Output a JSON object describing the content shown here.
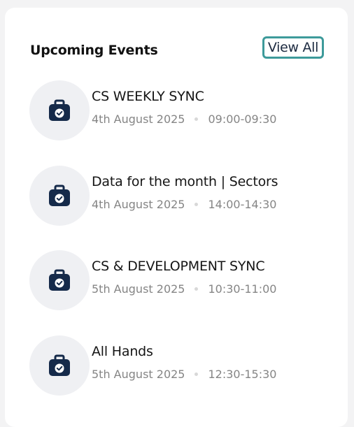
{
  "widget": {
    "title": "Upcoming Events",
    "view_all_label": "View All"
  },
  "events": [
    {
      "title": "CS WEEKLY SYNC",
      "date": "4th August 2025",
      "time": "09:00-09:30",
      "icon": "briefcase-check-icon"
    },
    {
      "title": "Data for the month | Sectors",
      "date": "4th August 2025",
      "time": "14:00-14:30",
      "icon": "briefcase-check-icon"
    },
    {
      "title": "CS & DEVELOPMENT SYNC",
      "date": "5th August 2025",
      "time": "10:30-11:00",
      "icon": "briefcase-check-icon"
    },
    {
      "title": "All Hands",
      "date": "5th August 2025",
      "time": "12:30-15:30",
      "icon": "briefcase-check-icon"
    }
  ],
  "colors": {
    "accent_border": "#3d9a9a",
    "icon_color": "#152a4a",
    "icon_bg": "#eff0f3"
  }
}
